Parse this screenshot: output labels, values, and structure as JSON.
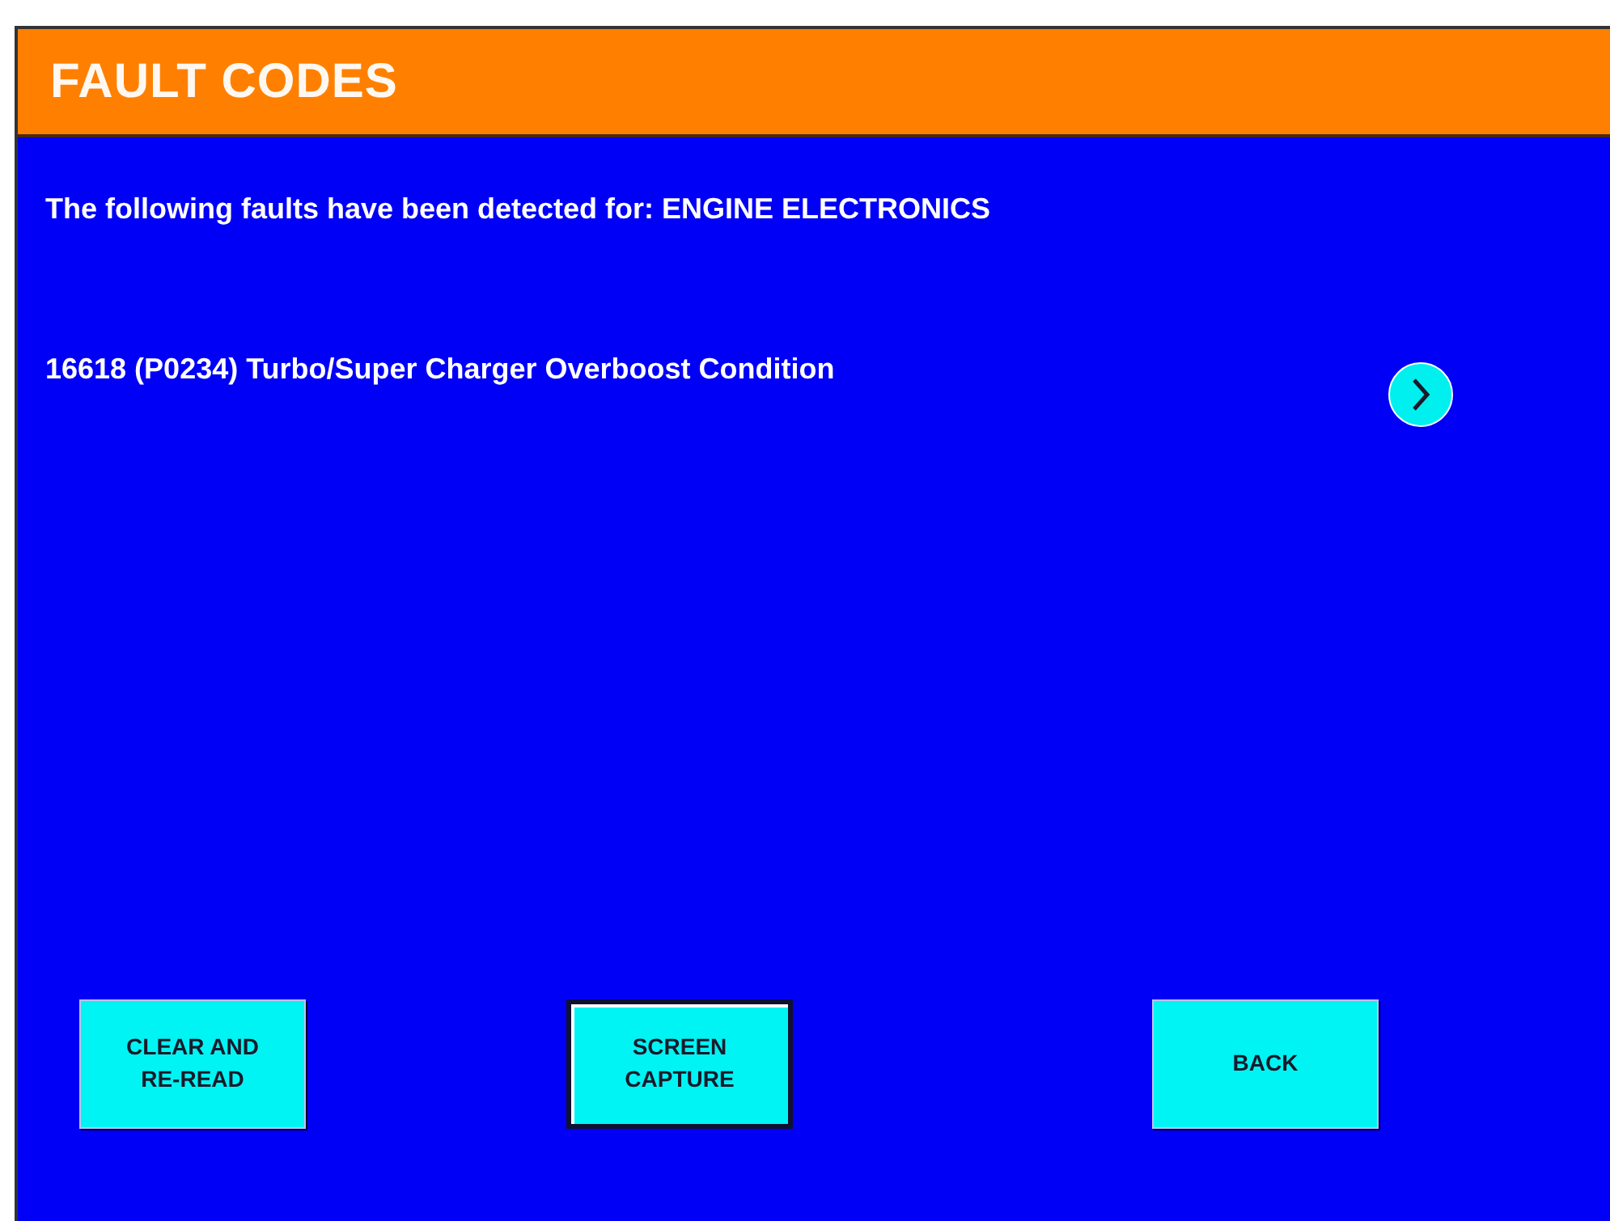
{
  "header": {
    "title": "FAULT CODES"
  },
  "intro": "The following faults have been detected for: ENGINE ELECTRONICS",
  "faults": [
    {
      "text": "16618 (P0234) Turbo/Super Charger Overboost Condition"
    }
  ],
  "buttons": [
    {
      "label": "CLEAR AND RE-READ",
      "focused": false
    },
    {
      "label": "SCREEN CAPTURE",
      "focused": true
    },
    {
      "label": "BACK",
      "focused": false
    }
  ]
}
